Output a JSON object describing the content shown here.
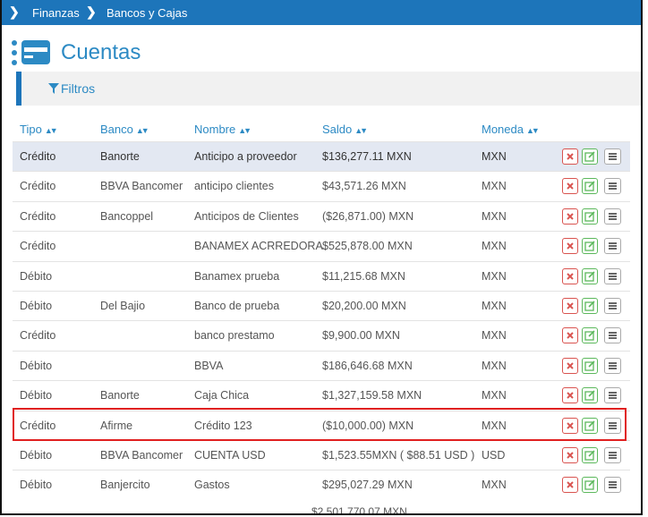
{
  "breadcrumb": {
    "items": [
      "Finanzas",
      "Bancos y Cajas"
    ]
  },
  "page": {
    "title": "Cuentas"
  },
  "filters": {
    "label": "Filtros"
  },
  "table": {
    "headers": [
      "Tipo",
      "Banco",
      "Nombre",
      "Saldo",
      "Moneda"
    ],
    "rows": [
      [
        "Crédito",
        "Banorte",
        "Anticipo a proveedor",
        "$136,277.11 MXN",
        "MXN"
      ],
      [
        "Crédito",
        "BBVA Bancomer",
        "anticipo clientes",
        "$43,571.26 MXN",
        "MXN"
      ],
      [
        "Crédito",
        "Bancoppel",
        "Anticipos de Clientes",
        "($26,871.00) MXN",
        "MXN"
      ],
      [
        "Crédito",
        "",
        "BANAMEX ACRREDORA",
        "$525,878.00 MXN",
        "MXN"
      ],
      [
        "Débito",
        "",
        "Banamex prueba",
        "$11,215.68 MXN",
        "MXN"
      ],
      [
        "Débito",
        "Del Bajio",
        "Banco de prueba",
        "$20,200.00 MXN",
        "MXN"
      ],
      [
        "Crédito",
        "",
        "banco prestamo",
        "$9,900.00 MXN",
        "MXN"
      ],
      [
        "Débito",
        "",
        "BBVA",
        "$186,646.68 MXN",
        "MXN"
      ],
      [
        "Débito",
        "Banorte",
        "Caja Chica",
        "$1,327,159.58 MXN",
        "MXN"
      ],
      [
        "Crédito",
        "Afirme",
        "Crédito 123",
        "($10,000.00) MXN",
        "MXN"
      ],
      [
        "Débito",
        "BBVA Bancomer",
        "CUENTA USD",
        "$1,523.55MXN ( $88.51 USD )",
        "USD"
      ],
      [
        "Débito",
        "Banjercito",
        "Gastos",
        "$295,027.29 MXN",
        "MXN"
      ]
    ],
    "partial_row_saldo": "$2,501,770.07 MXN"
  },
  "colors": {
    "primary": "#1d75ba",
    "accent_text": "#2c8ac4",
    "highlight_row": "#e3e8f2",
    "delete": "#d9534f",
    "edit": "#5cb85c",
    "annotation": "#e02020"
  },
  "icons": {
    "breadcrumb_separator": "chevron-right-icon",
    "title": "credit-card-icon",
    "filter": "filter-icon",
    "sort": "sort-icon",
    "row_actions": [
      "delete-icon",
      "edit-icon",
      "menu-icon"
    ]
  }
}
